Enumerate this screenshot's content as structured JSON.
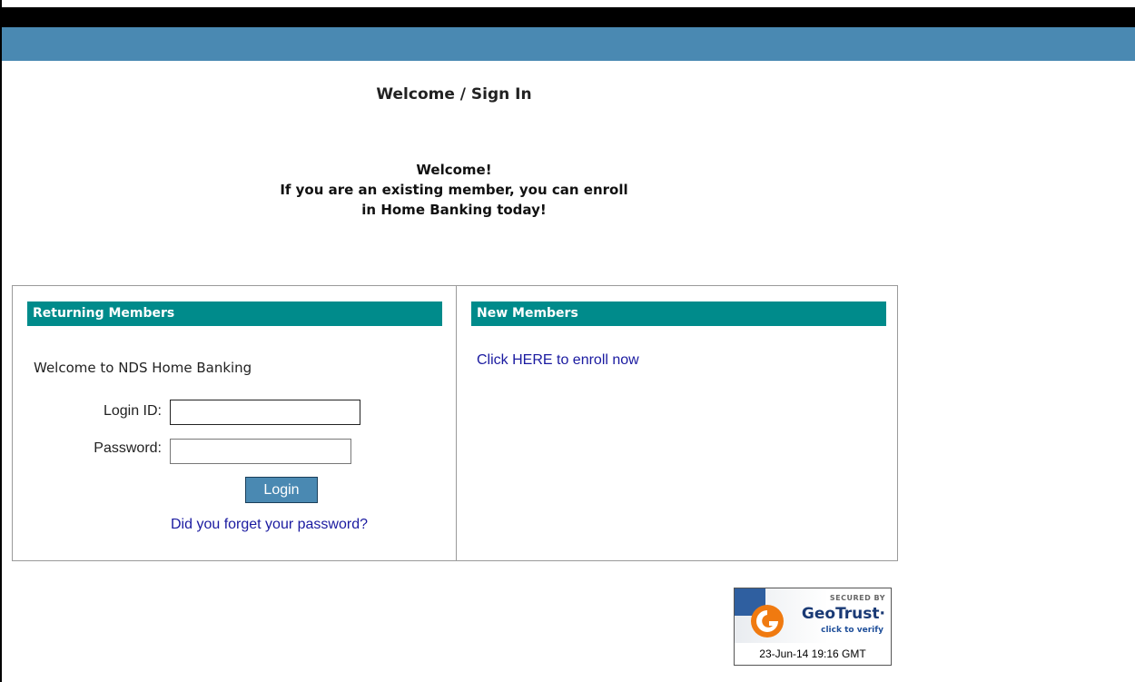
{
  "page": {
    "title": "Welcome / Sign In",
    "welcome_lines": [
      "Welcome!",
      "If you are an existing member, you can enroll",
      "in Home Banking today!"
    ]
  },
  "returning": {
    "header": "Returning Members",
    "intro": "Welcome to NDS Home Banking",
    "login_id_label": "Login ID:",
    "login_id_value": "",
    "password_label": "Password:",
    "password_value": "",
    "login_button": "Login",
    "forgot_link": "Did you forget your password?"
  },
  "new_members": {
    "header": "New Members",
    "enroll_link": "Click HERE to enroll now"
  },
  "seal": {
    "secured_by": "SECURED BY",
    "brand": "GeoTrust",
    "trademark": "·",
    "verify": "click to verify",
    "date": "23-Jun-14 19:16 GMT"
  },
  "colors": {
    "header_band": "#4a89b2",
    "section_header": "#008b8b",
    "link": "#1a1aa0",
    "button": "#4a89b2"
  }
}
